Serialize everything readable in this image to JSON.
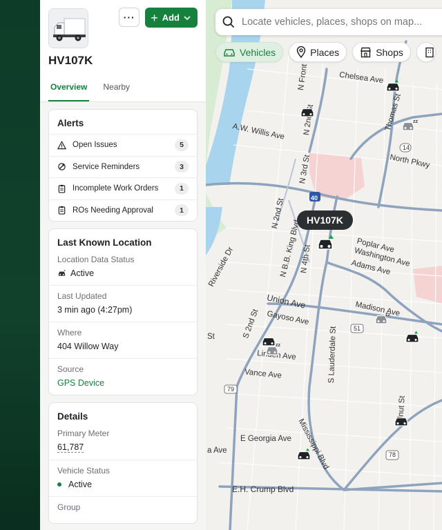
{
  "vehicle": {
    "name": "HV107K",
    "add_label": "Add",
    "more_label": "···"
  },
  "tabs": [
    {
      "label": "Overview"
    },
    {
      "label": "Nearby"
    }
  ],
  "alerts": {
    "title": "Alerts",
    "items": [
      {
        "label": "Open Issues",
        "count": "5",
        "icon": "warning-icon"
      },
      {
        "label": "Service Reminders",
        "count": "3",
        "icon": "service-icon"
      },
      {
        "label": "Incomplete Work Orders",
        "count": "1",
        "icon": "clipboard-icon"
      },
      {
        "label": "ROs Needing Approval",
        "count": "1",
        "icon": "clipboard-icon"
      }
    ]
  },
  "location": {
    "title": "Last Known Location",
    "status_label": "Location Data Status",
    "status_value": "Active",
    "updated_label": "Last Updated",
    "updated_value": "3 min ago (4:27pm)",
    "where_label": "Where",
    "where_value": "404 Willow Way",
    "source_label": "Source",
    "source_value": "GPS Device"
  },
  "details": {
    "title": "Details",
    "meter_label": "Primary Meter",
    "meter_value": "61,787",
    "status_label": "Vehicle Status",
    "status_value": "Active",
    "group_label": "Group"
  },
  "map": {
    "search_placeholder": "Locate vehicles, places, shops on map...",
    "chips": [
      {
        "label": "Vehicles"
      },
      {
        "label": "Places"
      },
      {
        "label": "Shops"
      }
    ],
    "selected_vehicle": "HV107K",
    "labels": {
      "chelsea": "Chelsea Ave",
      "willis": "A.W. Willis Ave",
      "northpkwy": "North Pkwy",
      "poplar": "Poplar Ave",
      "washington": "Washington Ave",
      "adams": "Adams Ave",
      "union": "Union Ave",
      "madison": "Madison Ave",
      "gayoso": "Gayoso Ave",
      "linden": "Linden Ave",
      "vance": "Vance Ave",
      "georgia": "E Georgia Ave",
      "crump": "E.H. Crump Blvd",
      "riverside": "Riverside Dr",
      "n2nd": "N 2nd St",
      "n3rd": "N 3rd St",
      "nfront": "N Front St",
      "n4th": "N 4th St",
      "bbking": "N B.B. King Blvd",
      "s2nd": "S 2nd St",
      "lauderdale": "S Lauderdale St",
      "mississippi": "Mississippi Blvd",
      "thomas": "Thomas St",
      "ave": "a Ave",
      "walnut": "alnut St",
      "st": "St",
      "shield40": "40",
      "shield14": "14",
      "shield51": "51",
      "shield79": "79",
      "shield78": "78"
    }
  },
  "colors": {
    "brand": "#16813d",
    "chip_active_bg": "#dff0e3",
    "callout_bg": "#2c2f31"
  }
}
